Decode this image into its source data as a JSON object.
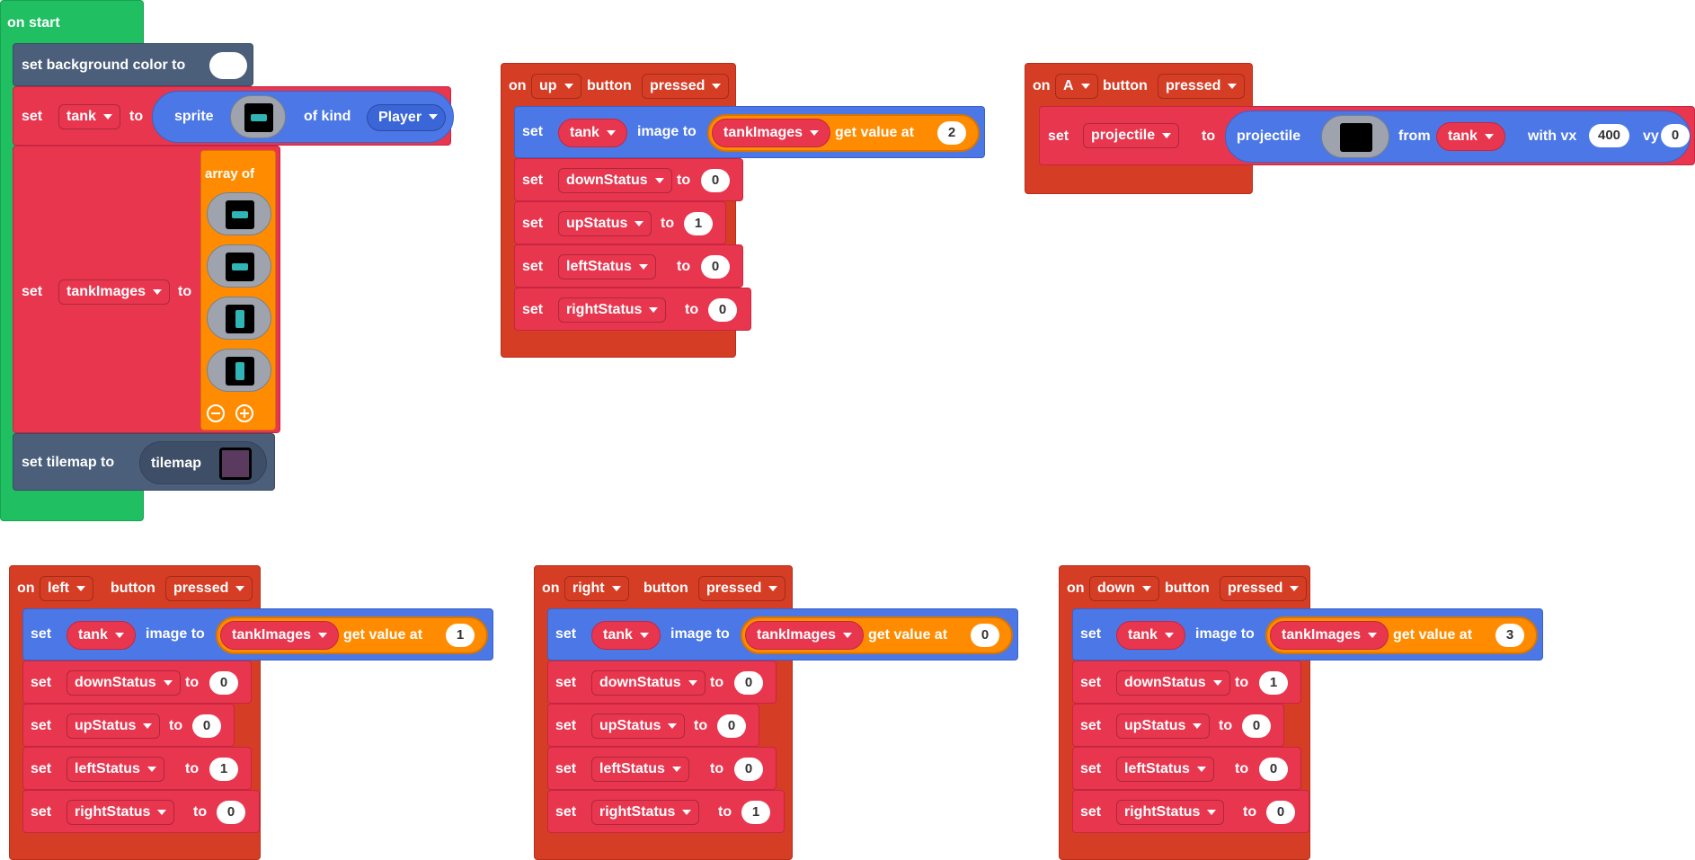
{
  "on_start": {
    "hat_label": "on start",
    "bg": {
      "label": "set background color to"
    },
    "set_tank": {
      "set": "set",
      "var": "tank",
      "to": "to",
      "sprite": "sprite",
      "of_kind": "of kind",
      "kind": "Player"
    },
    "set_images": {
      "set": "set",
      "var": "tankImages",
      "to": "to",
      "array_of": "array of",
      "remove_icon": "minus-circle-icon",
      "add_icon": "plus-circle-icon"
    },
    "tilemap": {
      "label": "set tilemap to",
      "reporter": "tilemap"
    }
  },
  "handlers": {
    "up": {
      "on": "on",
      "button_value": "up",
      "button": "button",
      "event": "pressed",
      "image": {
        "set": "set",
        "var": "tank",
        "image_to": "image to",
        "array": "tankImages",
        "get": "get value at",
        "index": "2"
      },
      "rows": [
        {
          "set": "set",
          "var": "downStatus",
          "to": "to",
          "value": "0"
        },
        {
          "set": "set",
          "var": "upStatus",
          "to": "to",
          "value": "1"
        },
        {
          "set": "set",
          "var": "leftStatus",
          "to": "to",
          "value": "0"
        },
        {
          "set": "set",
          "var": "rightStatus",
          "to": "to",
          "value": "0"
        }
      ]
    },
    "left": {
      "on": "on",
      "button_value": "left",
      "button": "button",
      "event": "pressed",
      "image": {
        "set": "set",
        "var": "tank",
        "image_to": "image to",
        "array": "tankImages",
        "get": "get value at",
        "index": "1"
      },
      "rows": [
        {
          "set": "set",
          "var": "downStatus",
          "to": "to",
          "value": "0"
        },
        {
          "set": "set",
          "var": "upStatus",
          "to": "to",
          "value": "0"
        },
        {
          "set": "set",
          "var": "leftStatus",
          "to": "to",
          "value": "1"
        },
        {
          "set": "set",
          "var": "rightStatus",
          "to": "to",
          "value": "0"
        }
      ]
    },
    "right": {
      "on": "on",
      "button_value": "right",
      "button": "button",
      "event": "pressed",
      "image": {
        "set": "set",
        "var": "tank",
        "image_to": "image to",
        "array": "tankImages",
        "get": "get value at",
        "index": "0"
      },
      "rows": [
        {
          "set": "set",
          "var": "downStatus",
          "to": "to",
          "value": "0"
        },
        {
          "set": "set",
          "var": "upStatus",
          "to": "to",
          "value": "0"
        },
        {
          "set": "set",
          "var": "leftStatus",
          "to": "to",
          "value": "0"
        },
        {
          "set": "set",
          "var": "rightStatus",
          "to": "to",
          "value": "1"
        }
      ]
    },
    "down": {
      "on": "on",
      "button_value": "down",
      "button": "button",
      "event": "pressed",
      "image": {
        "set": "set",
        "var": "tank",
        "image_to": "image to",
        "array": "tankImages",
        "get": "get value at",
        "index": "3"
      },
      "rows": [
        {
          "set": "set",
          "var": "downStatus",
          "to": "to",
          "value": "1"
        },
        {
          "set": "set",
          "var": "upStatus",
          "to": "to",
          "value": "0"
        },
        {
          "set": "set",
          "var": "leftStatus",
          "to": "to",
          "value": "0"
        },
        {
          "set": "set",
          "var": "rightStatus",
          "to": "to",
          "value": "0"
        }
      ]
    }
  },
  "a_handler": {
    "on": "on",
    "button_value": "A",
    "button": "button",
    "event": "pressed",
    "set": "set",
    "var": "projectile",
    "to": "to",
    "reporter": "projectile",
    "from": "from",
    "source": "tank",
    "with_vx": "with vx",
    "vx": "400",
    "vy_label": "vy",
    "vy": "0"
  },
  "colors": {
    "event_green": "#1fbf62",
    "event_orange": "#d63d25",
    "variables_red": "#e8364f",
    "sprites_blue": "#4b78e6",
    "arrays_orange": "#ff8c00",
    "scene_slate": "#4b5f7b"
  }
}
